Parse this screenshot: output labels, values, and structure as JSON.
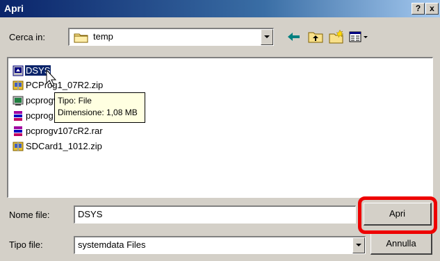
{
  "window": {
    "title": "Apri",
    "help_label": "?",
    "close_label": "x"
  },
  "lookin": {
    "label": "Cerca in:",
    "value": "temp"
  },
  "files": [
    {
      "name": "DSYS",
      "icon": "system-file-icon",
      "selected": true
    },
    {
      "name": "PCProg1_07R2.zip",
      "icon": "zip-icon"
    },
    {
      "name": "pcprogv107...",
      "icon": "program-icon"
    },
    {
      "name": "pcprog...",
      "icon": "rar-icon"
    },
    {
      "name": "pcprogv107cR2.rar",
      "icon": "rar-icon"
    },
    {
      "name": "SDCard1_1012.zip",
      "icon": "zip-icon"
    }
  ],
  "tooltip": {
    "line1": "Tipo: File",
    "line2": "Dimensione: 1,08 MB"
  },
  "filename": {
    "label": "Nome file:",
    "value": "DSYS"
  },
  "filetype": {
    "label": "Tipo file:",
    "value": "systemdata Files"
  },
  "buttons": {
    "open": "Apri",
    "cancel": "Annulla"
  },
  "colors": {
    "title_bar": "#0a246a",
    "selection": "#0a246a",
    "highlight": "#ee0000",
    "tooltip_bg": "#ffffe1"
  }
}
